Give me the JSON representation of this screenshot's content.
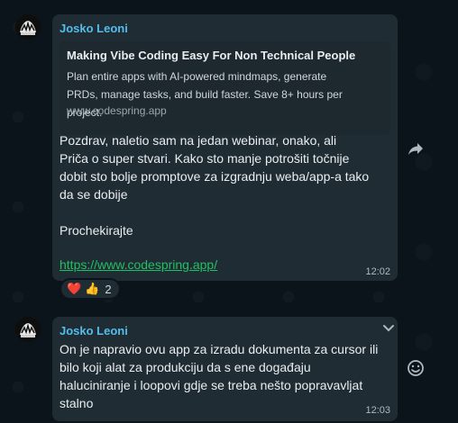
{
  "messages": [
    {
      "sender": "Josko Leoni",
      "preview": {
        "title": "Making Vibe Coding Easy For Non Technical People",
        "description": "Plan entire apps with AI-powered mindmaps, generate PRDs, manage tasks, and build faster. Save 8+ hours per project.",
        "url": "www.codespring.app"
      },
      "lines": [
        "Pozdrav, naletio sam na jedan webinar, onako, ali",
        "Priča o super stvari. Kako sto manje potrošiti točnije",
        "dobit sto bolje promptove za izgradnju weba/app-a tako",
        "da se dobije",
        "",
        "Prochekirajte"
      ],
      "link": "https://www.codespring.app/",
      "time": "12:02",
      "reactions": {
        "heart": "❤️",
        "thumbs": "👍",
        "count": "2"
      }
    },
    {
      "sender": "Josko Leoni",
      "lines": [
        "On je napravio ovu app za izradu dokumenta za cursor ili",
        "bilo koji alat za produkciju da s ene događaju",
        "haluciniranje i loopovi gdje se treba nešto popravavljat",
        "stalno"
      ],
      "time": "12:03"
    }
  ],
  "icons": {
    "forward": "forward-icon",
    "chevron": "chevron-down-icon",
    "emoji": "emoji-icon"
  },
  "colors": {
    "background": "#0b141a",
    "bubble": "#202c33",
    "sender": "#53bdeb",
    "link": "#21c063"
  }
}
